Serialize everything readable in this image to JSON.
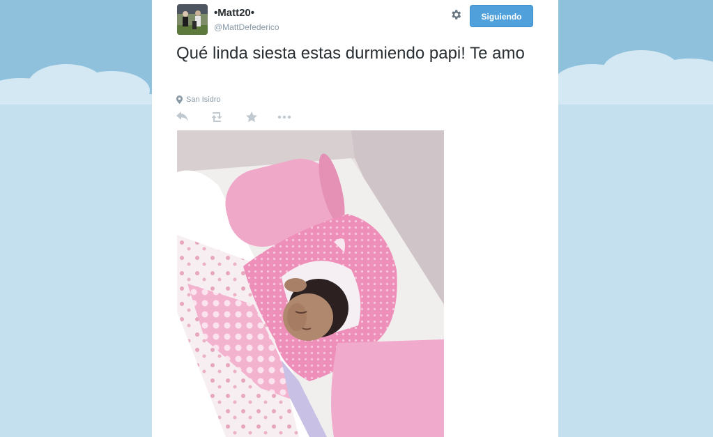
{
  "tweet": {
    "display_name": "•Matt20•",
    "username": "@MattDefederico",
    "follow_label": "Siguiendo",
    "text": "Qué linda siesta estas durmiendo papi! Te amo",
    "location": "San Isidro"
  },
  "icons": {
    "settings": "gear-icon",
    "location": "map-pin-icon",
    "reply": "reply-icon",
    "retweet": "retweet-icon",
    "favorite": "star-icon",
    "more": "more-icon"
  },
  "colors": {
    "follow_button": "#4fa0db",
    "background_sky": "#c4e0ee",
    "background_top": "#8fc1dd",
    "muted_text": "#8899a6"
  }
}
